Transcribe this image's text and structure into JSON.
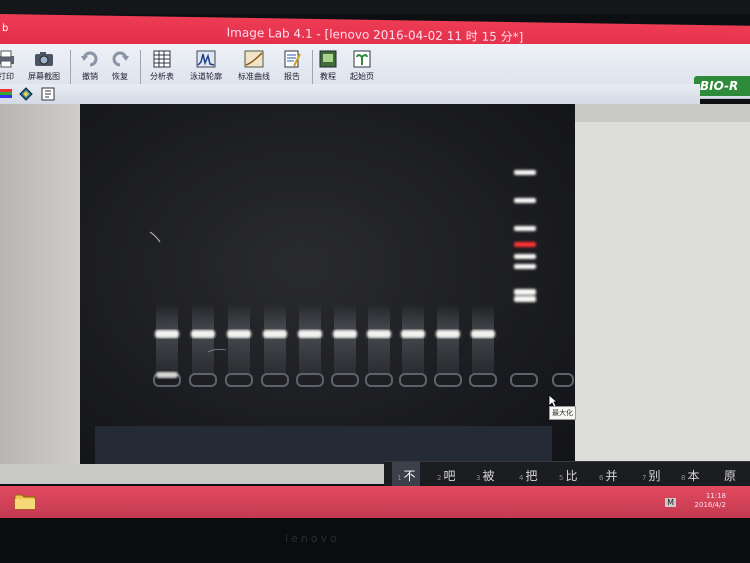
{
  "window": {
    "title": "Image Lab 4.1 - [lenovo 2016-04-02 11 时 15 分*]",
    "corner": "b"
  },
  "toolbar": {
    "items": [
      {
        "label": "打印"
      },
      {
        "label": "屏幕截图"
      },
      {
        "label": "撤销"
      },
      {
        "label": "恢复"
      },
      {
        "label": "分析表"
      },
      {
        "label": "泳道轮廓"
      },
      {
        "label": "标准曲线"
      },
      {
        "label": "报告"
      },
      {
        "label": "教程"
      },
      {
        "label": "起始页"
      }
    ],
    "brand": "BIO-R"
  },
  "gel": {
    "sample_lane_count": 10,
    "ladder_present": true
  },
  "tooltip": "最大化",
  "ime": {
    "candidates": [
      {
        "num": "1",
        "text": "不"
      },
      {
        "num": "2",
        "text": "吧"
      },
      {
        "num": "3",
        "text": "被"
      },
      {
        "num": "4",
        "text": "把"
      },
      {
        "num": "5",
        "text": "比"
      },
      {
        "num": "6",
        "text": "并"
      },
      {
        "num": "7",
        "text": "别"
      },
      {
        "num": "8",
        "text": "本"
      },
      {
        "num": "",
        "text": "原"
      }
    ]
  },
  "taskbar": {
    "time": "11:18",
    "date": "2016/4/2",
    "tray_label": "M"
  },
  "bezel": {
    "brand": "lenovo"
  },
  "colors": {
    "title_bar": "#e22e48",
    "ladder_highlight": "#ff3333",
    "brand_green": "#2e8b3a"
  }
}
